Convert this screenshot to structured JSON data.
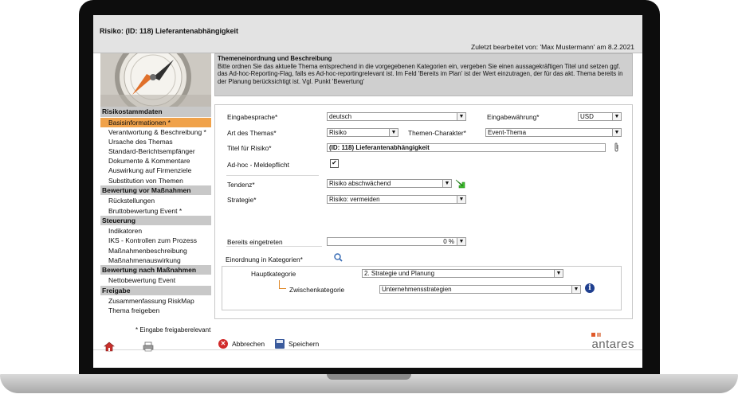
{
  "window": {
    "title": "Risiko: (ID: 118) Lieferantenabhängigkeit",
    "last_edited": "Zuletzt bearbeitet von: 'Max Mustermann' am 8.2.2021"
  },
  "info": {
    "heading": "Themeneinordnung und Beschreibung",
    "text": "Bitte ordnen Sie das aktuelle Thema entsprechend in die vorgegebenen Kategorien ein, vergeben Sie einen aussagekräftigen Titel und setzen ggf. das Ad-hoc-Reporting-Flag, falls es Ad-hoc-reportingrelevant ist. Im Feld 'Bereits im Plan' ist der Wert einzutragen, der für das akt. Thema bereits in der Planung berücksichtigt ist. Vgl. Punkt 'Bewertung'"
  },
  "sidebar": {
    "sections": [
      {
        "title": "Risikostammdaten",
        "items": [
          "Basisinformationen *",
          "Verantwortung & Beschreibung *",
          "Ursache des Themas",
          "Standard-Berichtsempfänger",
          "Dokumente & Kommentare",
          "Auswirkung auf Firmenziele",
          "Substitution von Themen"
        ]
      },
      {
        "title": "Bewertung vor Maßnahmen",
        "items": [
          "Rückstellungen",
          "Bruttobewertung Event *"
        ]
      },
      {
        "title": "Steuerung",
        "items": [
          "Indikatoren",
          "IKS - Kontrollen zum Prozess",
          "Maßnahmenbeschreibung",
          "Maßnahmenauswirkung"
        ]
      },
      {
        "title": "Bewertung nach Maßnahmen",
        "items": [
          "Nettobewertung Event"
        ]
      },
      {
        "title": "Freigabe",
        "items": [
          "Zusammenfassung RiskMap",
          "Thema freigeben"
        ]
      }
    ],
    "active_item": "Basisinformationen *",
    "note": "* Eingabe freigaberelevant"
  },
  "form": {
    "eingabesprache": {
      "label": "Eingabesprache*",
      "value": "deutsch"
    },
    "eingabewaehrung": {
      "label": "Eingabewährung*",
      "value": "USD"
    },
    "art": {
      "label": "Art des Themas*",
      "value": "Risiko"
    },
    "charakter": {
      "label": "Themen-Charakter*",
      "value": "Event-Thema"
    },
    "titel": {
      "label": "Titel für Risiko*",
      "value": "(ID: 118) Lieferantenabhängigkeit"
    },
    "adhoc": {
      "label": "Ad-hoc - Meldepflicht",
      "checked": true,
      "mark": "✔"
    },
    "tendenz": {
      "label": "Tendenz*",
      "value": "Risiko abschwächend"
    },
    "strategie": {
      "label": "Strategie*",
      "value": "Risiko: vermeiden"
    },
    "bereits": {
      "label": "Bereits eingetreten",
      "value": "0 %"
    },
    "kategorien": {
      "label": "Einordnung in Kategorien*",
      "haupt": {
        "label": "Hauptkategorie",
        "value": "2. Strategie und Planung"
      },
      "zwischen": {
        "label": "Zwischenkategorie",
        "value": "Unternehmensstrategien"
      }
    }
  },
  "footer": {
    "cancel": "Abbrechen",
    "save": "Speichern",
    "logo": "antares"
  },
  "colors": {
    "active": "#f0a24a",
    "section": "#c8c8c8",
    "logo_accent": "#e05a2a"
  }
}
